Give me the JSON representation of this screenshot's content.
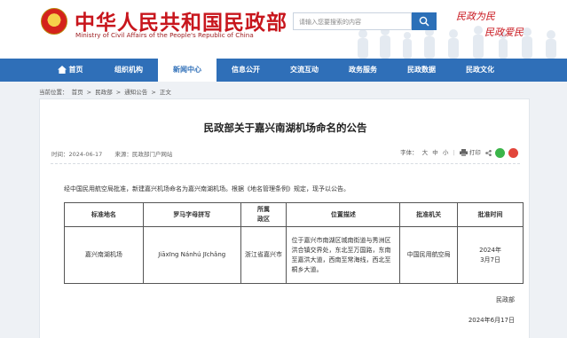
{
  "header": {
    "site_title": "中华人民共和国民政部",
    "site_subtitle": "Ministry of Civil Affairs of the People's Republic of China",
    "search_placeholder": "请输入您要搜索的内容",
    "slogan_line1": "民政为民",
    "slogan_line2": "民政爱民"
  },
  "nav": {
    "items": [
      {
        "label": "首页"
      },
      {
        "label": "组织机构"
      },
      {
        "label": "新闻中心"
      },
      {
        "label": "信息公开"
      },
      {
        "label": "交流互动"
      },
      {
        "label": "政务服务"
      },
      {
        "label": "民政数据"
      },
      {
        "label": "民政文化"
      }
    ],
    "active": "新闻中心"
  },
  "breadcrumb": {
    "prefix": "当前位置：",
    "items": [
      "首页",
      "民政部",
      "通知公告",
      "正文"
    ],
    "separator": ">"
  },
  "article": {
    "title": "民政部关于嘉兴南湖机场命名的公告",
    "time_label": "时间：2024-06-17",
    "source_label": "来源：民政部门户网站",
    "font_label": "字体：",
    "font_large": "大",
    "font_medium": "中",
    "font_small": "小",
    "print_label": "打印",
    "intro": "经中国民用航空局批准，新建嘉兴机场命名为嘉兴南湖机场。根据《地名管理条例》规定，现予以公告。",
    "table": {
      "headers": [
        "标准地名",
        "罗马字母拼写",
        "所属\n政区",
        "位置描述",
        "批准机关",
        "批准时间"
      ],
      "rows": [
        {
          "name": "嘉兴南湖机场",
          "roman": "Jiāxīng Nánhú Jīchǎng",
          "region": "浙江省嘉兴市",
          "desc": "位于嘉兴市南湖区城南街道与秀洲区洪合镇交界处，东北至万国路，东南至嘉洪大道，西南至常海线，西北至桐乡大道。",
          "authority": "中国民用航空局",
          "date": "2024年\n3月7日"
        }
      ]
    },
    "signature": "民政部",
    "sign_date": "2024年6月17日"
  },
  "colors": {
    "brand_red": "#c8161d",
    "nav_blue": "#2f6fb8",
    "wechat_green": "#3bb54a",
    "weibo_red": "#e2463b"
  }
}
